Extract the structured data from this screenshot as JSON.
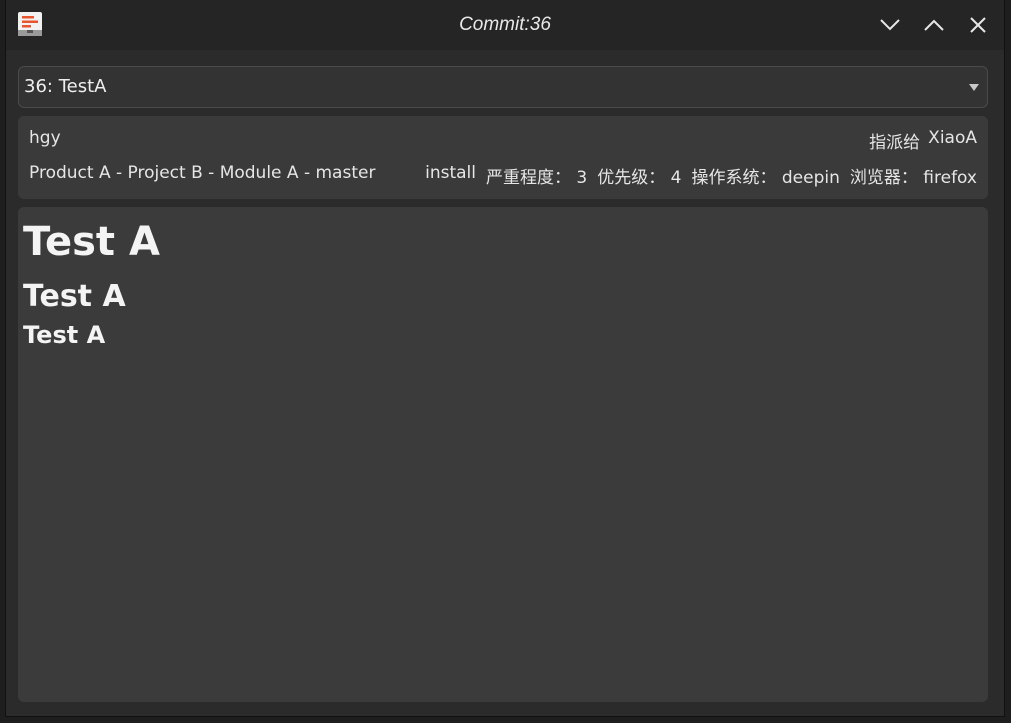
{
  "window": {
    "title": "Commit:36",
    "buttons": {
      "minimize": "chevron-down-icon",
      "maximize": "chevron-up-icon",
      "close": "close-icon"
    }
  },
  "selector": {
    "value": "36: TestA"
  },
  "info": {
    "author": "hgy",
    "assigned_label": "指派给",
    "assigned_to": "XiaoA",
    "path": "Product A - Project B - Module A - master",
    "meta": [
      {
        "label": "install"
      },
      {
        "label": "严重程度：",
        "value": "3"
      },
      {
        "label": "优先级：",
        "value": "4"
      },
      {
        "label": "操作系统：",
        "value": "deepin"
      },
      {
        "label": "浏览器：",
        "value": "firefox"
      }
    ]
  },
  "content": {
    "heading1": "Test A",
    "heading2": "Test A",
    "heading3": "Test A"
  },
  "colors": {
    "titlebar": "#252525",
    "window_bg": "#2b2b2b",
    "panel_bg": "#3a3a3a",
    "accent_icon": "#e8552e"
  }
}
